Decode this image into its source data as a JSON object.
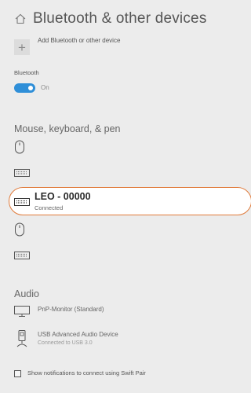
{
  "header": {
    "title": "Bluetooth & other devices",
    "home_icon": "home-icon"
  },
  "add_device": {
    "icon": "plus-icon",
    "label": "Add Bluetooth or other device"
  },
  "bluetooth": {
    "label": "Bluetooth",
    "toggle_state": "On",
    "toggle_on": true,
    "accent": "#2f8fd8"
  },
  "mouse_section": {
    "title": "Mouse, keyboard, & pen",
    "highlighted_device": {
      "name": "LEO - 00000",
      "status": "Connected",
      "icon": "keyboard-icon",
      "highlight_color": "#e07a3a"
    },
    "devices": [
      {
        "icon": "mouse-icon"
      },
      {
        "icon": "keyboard-icon"
      },
      {
        "icon": "mouse-icon"
      },
      {
        "icon": "keyboard-icon"
      }
    ]
  },
  "audio_section": {
    "title": "Audio",
    "devices": [
      {
        "name": "PnP-Monitor (Standard)",
        "status": "",
        "icon": "monitor-icon"
      },
      {
        "name": "USB Advanced Audio Device",
        "status": "Connected to USB 3.0",
        "icon": "usb-audio-icon"
      }
    ]
  },
  "swift_pair": {
    "label": "Show notifications to connect using Swift Pair",
    "checked": false
  }
}
